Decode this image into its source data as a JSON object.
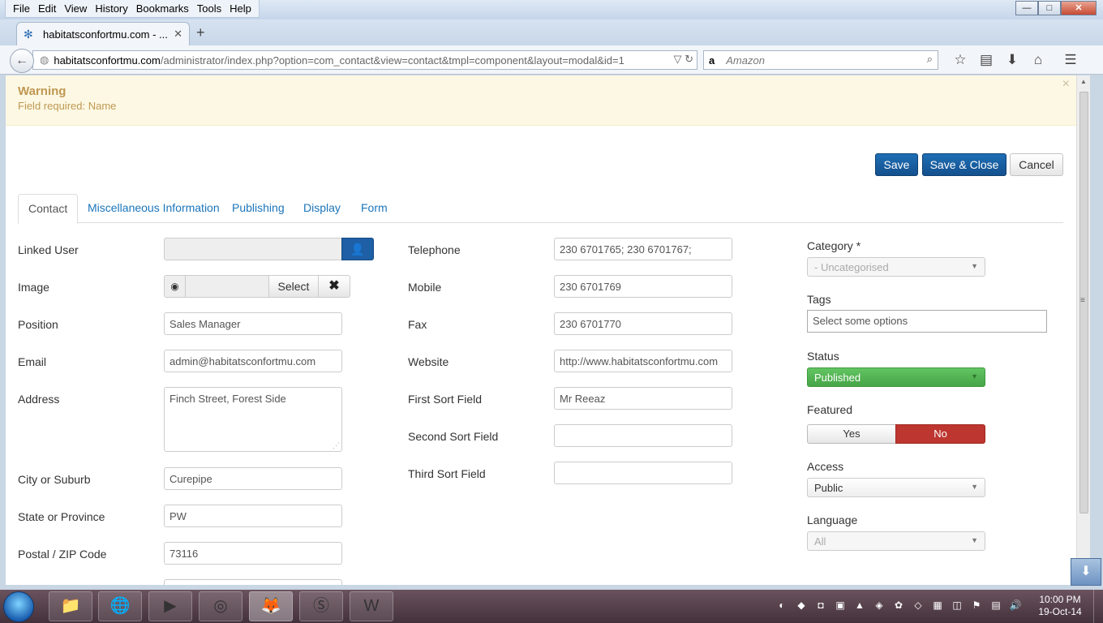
{
  "browser": {
    "menu": [
      "File",
      "Edit",
      "View",
      "History",
      "Bookmarks",
      "Tools",
      "Help"
    ],
    "tab_title": "habitatsconfortmu.com - ...",
    "url_host": "habitatsconfortmu.com",
    "url_path": "/administrator/index.php?option=com_contact&view=contact&tmpl=component&layout=modal&id=1",
    "search_engine": "a",
    "search_placeholder": "Amazon",
    "min": "—",
    "max": "□",
    "close": "✕"
  },
  "alert": {
    "heading": "Warning",
    "message": "Field required: Name"
  },
  "toolbar": {
    "save": "Save",
    "save_close": "Save & Close",
    "cancel": "Cancel"
  },
  "tabs": [
    "Contact",
    "Miscellaneous Information",
    "Publishing",
    "Display",
    "Form"
  ],
  "left": {
    "linked_user_label": "Linked User",
    "image_label": "Image",
    "image_select": "Select",
    "position_label": "Position",
    "position_value": "Sales Manager",
    "email_label": "Email",
    "email_value": "admin@habitatsconfortmu.com",
    "address_label": "Address",
    "address_value": "Finch Street, Forest Side",
    "city_label": "City or Suburb",
    "city_value": "Curepipe",
    "state_label": "State or Province",
    "state_value": "PW",
    "postal_label": "Postal / ZIP Code",
    "postal_value": "73116"
  },
  "middle": {
    "telephone_label": "Telephone",
    "telephone_value": "230 6701765;  230 6701767;",
    "mobile_label": "Mobile",
    "mobile_value": "230 6701769",
    "fax_label": "Fax",
    "fax_value": "230 6701770",
    "website_label": "Website",
    "website_value": "http://www.habitatsconfortmu.com",
    "first_sort_label": "First Sort Field",
    "first_sort_value": "Mr Reeaz",
    "second_sort_label": "Second Sort Field",
    "second_sort_value": "",
    "third_sort_label": "Third Sort Field",
    "third_sort_value": ""
  },
  "right": {
    "category_label": "Category *",
    "category_value": "- Uncategorised",
    "tags_label": "Tags",
    "tags_placeholder": "Select some options",
    "status_label": "Status",
    "status_value": "Published",
    "featured_label": "Featured",
    "featured_yes": "Yes",
    "featured_no": "No",
    "access_label": "Access",
    "access_value": "Public",
    "language_label": "Language",
    "language_value": "All"
  },
  "taskbar": {
    "time": "10:00 PM",
    "date": "19-Oct-14"
  },
  "colors": {
    "primary": "#1e6eb5",
    "warning_bg": "#fcf8e3",
    "warning_text": "#c09853",
    "published": "#46a546",
    "no_active": "#bd362f",
    "link": "#1b75bb"
  }
}
